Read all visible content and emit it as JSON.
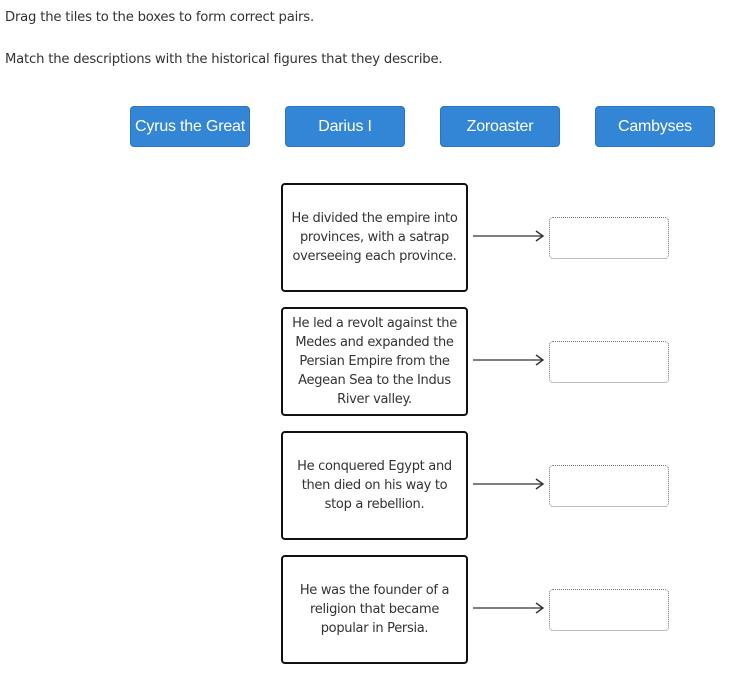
{
  "instructions": [
    "Drag the tiles to the boxes to form correct pairs.",
    "Match the descriptions with the historical figures that they describe."
  ],
  "colors": {
    "tile_background": "#3385d6",
    "tile_text": "#ffffff",
    "description_border": "#111111",
    "dropbox_border": "#777777"
  },
  "tiles": [
    {
      "label": "Cyrus the Great"
    },
    {
      "label": "Darius I"
    },
    {
      "label": "Zoroaster"
    },
    {
      "label": "Cambyses"
    }
  ],
  "pairs": [
    {
      "description": "He divided the empire into provinces, with a satrap overseeing each province.",
      "answer": ""
    },
    {
      "description": "He led a revolt against the Medes and expanded the Persian Empire from the Aegean Sea to the Indus River valley.",
      "answer": ""
    },
    {
      "description": "He conquered Egypt and then died on his way to stop a rebellion.",
      "answer": ""
    },
    {
      "description": "He was the founder of a religion that became popular in Persia.",
      "answer": ""
    }
  ]
}
